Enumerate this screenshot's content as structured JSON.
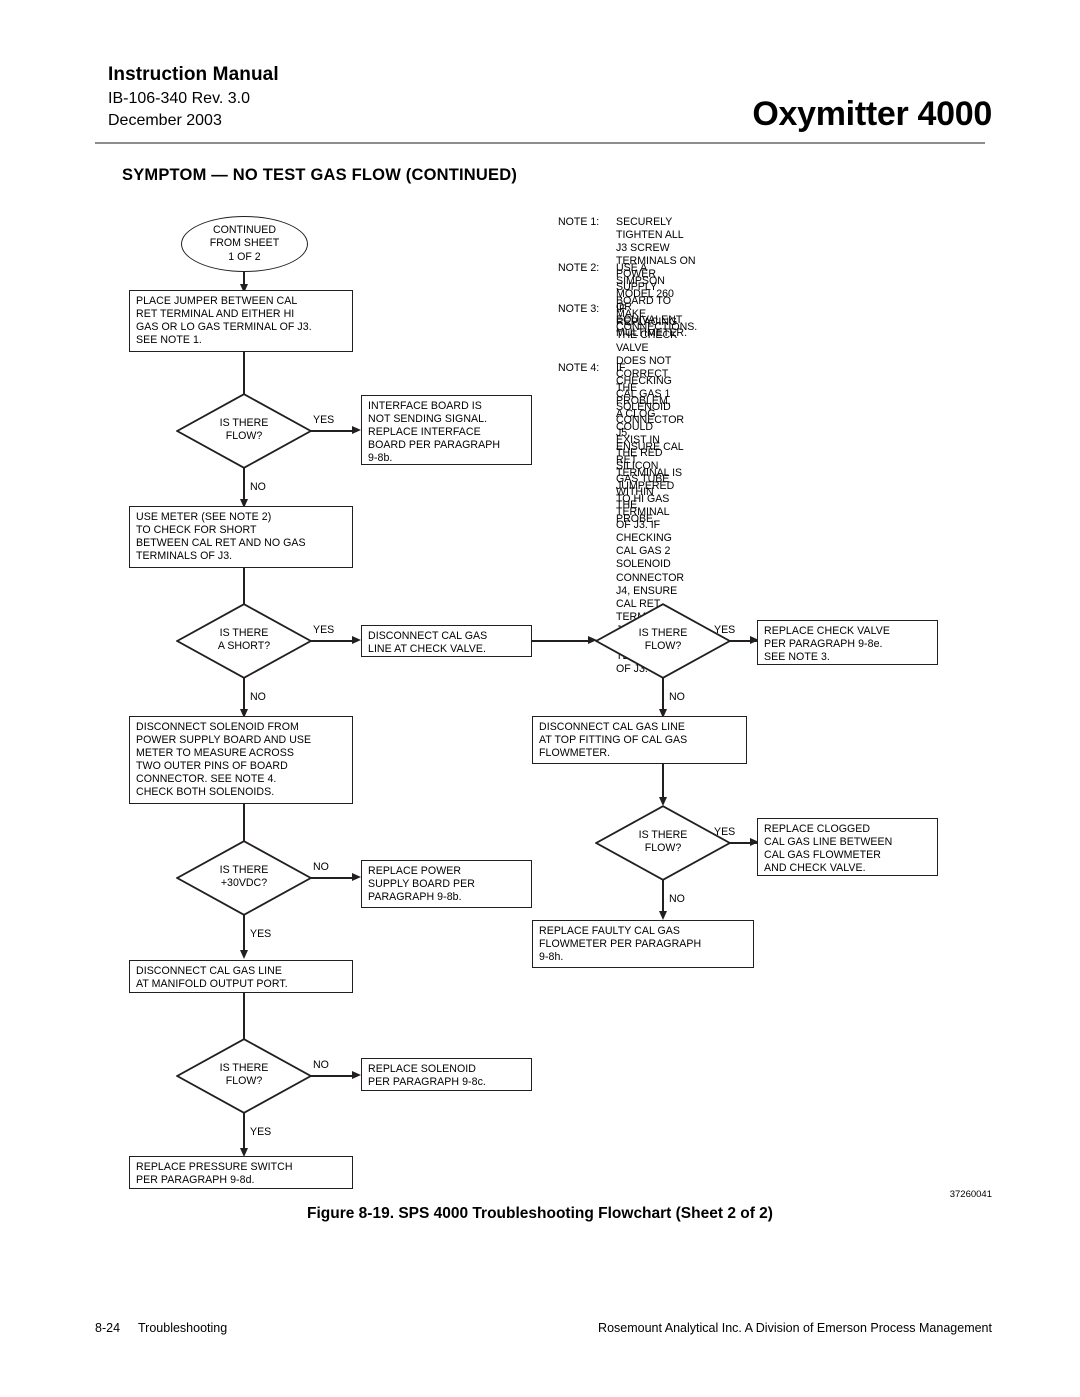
{
  "header": {
    "manual_title": "Instruction Manual",
    "doc_number": "IB-106-340  Rev. 3.0",
    "date": "December 2003",
    "product": "Oxymitter 4000"
  },
  "symptom_heading": "SYMPTOM — NO TEST GAS FLOW (CONTINUED)",
  "flowchart": {
    "start_oval": "CONTINUED\nFROM SHEET\n1 OF 2",
    "box_place_jumper": "PLACE JUMPER BETWEEN CAL\nRET TERMINAL AND EITHER HI\nGAS OR LO GAS TERMINAL OF J3.\nSEE NOTE 1.",
    "diamond_flow_1": "IS THERE\nFLOW?",
    "box_interface_board": "INTERFACE BOARD IS\nNOT SENDING SIGNAL.\nREPLACE INTERFACE\nBOARD PER PARAGRAPH\n9-8b.",
    "box_use_meter": "USE METER (SEE NOTE 2)\nTO CHECK FOR SHORT\nBETWEEN CAL RET AND NO GAS\nTERMINALS OF J3.",
    "diamond_short": "IS THERE\nA SHORT?",
    "box_disconnect_check_valve": "DISCONNECT CAL GAS\nLINE AT CHECK VALVE.",
    "diamond_flow_2": "IS THERE\nFLOW?",
    "box_replace_check_valve": "REPLACE CHECK VALVE\nPER PARAGRAPH 9-8e.\nSEE NOTE 3.",
    "box_disconnect_solenoid": "DISCONNECT SOLENOID FROM\nPOWER SUPPLY BOARD AND USE\nMETER TO MEASURE ACROSS\nTWO OUTER PINS OF BOARD\nCONNECTOR. SEE NOTE 4.\nCHECK BOTH SOLENOIDS.",
    "box_disconnect_flowmeter": "DISCONNECT CAL GAS LINE\nAT TOP FITTING OF CAL GAS\nFLOWMETER.",
    "diamond_flow_3": "IS THERE\nFLOW?",
    "box_replace_clogged": "REPLACE CLOGGED\nCAL GAS LINE BETWEEN\nCAL GAS FLOWMETER\nAND CHECK VALVE.",
    "diamond_30vdc": "IS THERE\n+30VDC?",
    "box_replace_power_supply": "REPLACE POWER\nSUPPLY BOARD PER\nPARAGRAPH 9-8b.",
    "box_replace_flowmeter": "REPLACE FAULTY CAL GAS\nFLOWMETER PER PARAGRAPH\n9-8h.",
    "box_disconnect_manifold": "DISCONNECT CAL GAS LINE\nAT MANIFOLD OUTPUT PORT.",
    "diamond_flow_4": "IS THERE\nFLOW?",
    "box_replace_solenoid": "REPLACE SOLENOID\nPER PARAGRAPH 9-8c.",
    "box_replace_pressure_switch": "REPLACE PRESSURE SWITCH\nPER PARAGRAPH 9-8d.",
    "labels": {
      "yes": "YES",
      "no": "NO"
    }
  },
  "notes": [
    {
      "tag": "NOTE 1:",
      "text": "SECURELY TIGHTEN ALL J3 SCREW TERMINALS ON\nPOWER SUPPLY BOARD TO MAKE CONNECTIONS."
    },
    {
      "tag": "NOTE 2:",
      "text": "USE A SIMPSON MODEL 260 OR EQUIVALENT\nMULTIMETER."
    },
    {
      "tag": "NOTE 3:",
      "text": "IF REPLACING THE CHECK VALVE DOES NOT\nCORRECT THE PROBLEM, A CLOG COULD EXIST IN\nTHE RED SILICON GAS TUBE WITHIN THE PROBE."
    },
    {
      "tag": "NOTE 4:",
      "text": "IF CHECKING CAL GAS 1 SOLENOID CONNECTOR J5,\nENSURE CAL RET TERMINAL IS JUMPERED TO HI GAS\nTERMINAL OF J3. IF CHECKING CAL GAS 2 SOLENOID\nCONNECTOR J4,  ENSURE CAL RET TERMINAL IS\nJUMPERED TO LO GAS TERMINAL OF J3."
    }
  ],
  "figure": {
    "caption": "Figure 8-19.  SPS 4000 Troubleshooting Flowchart (Sheet 2 of 2)",
    "part_number": "37260041"
  },
  "footer": {
    "page_number": "8-24",
    "section": "Troubleshooting",
    "company": "Rosemount Analytical Inc.   A Division of Emerson Process Management"
  }
}
